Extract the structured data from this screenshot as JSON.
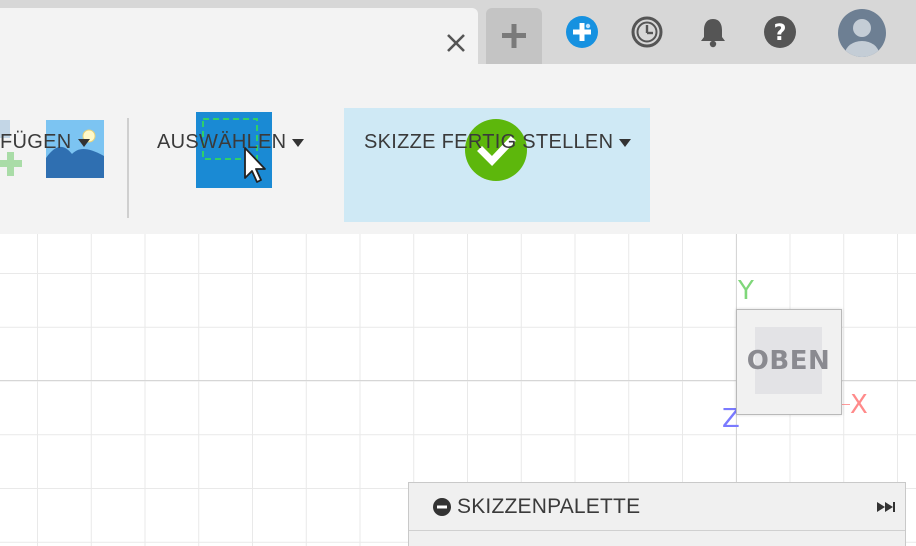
{
  "tabbar": {
    "close_glyph": "×",
    "new_tab_glyph": "+",
    "icons": [
      "extensions-icon",
      "clock-icon",
      "bell-icon",
      "help-icon",
      "avatar"
    ],
    "help_glyph": "?"
  },
  "toolbar": {
    "insert_label": "FÜGEN",
    "select_label": "AUSWÄHLEN",
    "finish_label": "SKIZZE FERTIG STELLEN",
    "select_accent": "#1a8ad4",
    "finish_accent": "#5db70c",
    "finish_bg": "#cfe9f5"
  },
  "viewcube": {
    "face_label": "OBEN",
    "axis_y": "Y",
    "axis_x": "X",
    "axis_z": "Z",
    "colors": {
      "y": "#7fd77a",
      "x": "#ff8a8a",
      "z": "#7a7aff"
    }
  },
  "palette": {
    "title": "SKIZZENPALETTE"
  }
}
